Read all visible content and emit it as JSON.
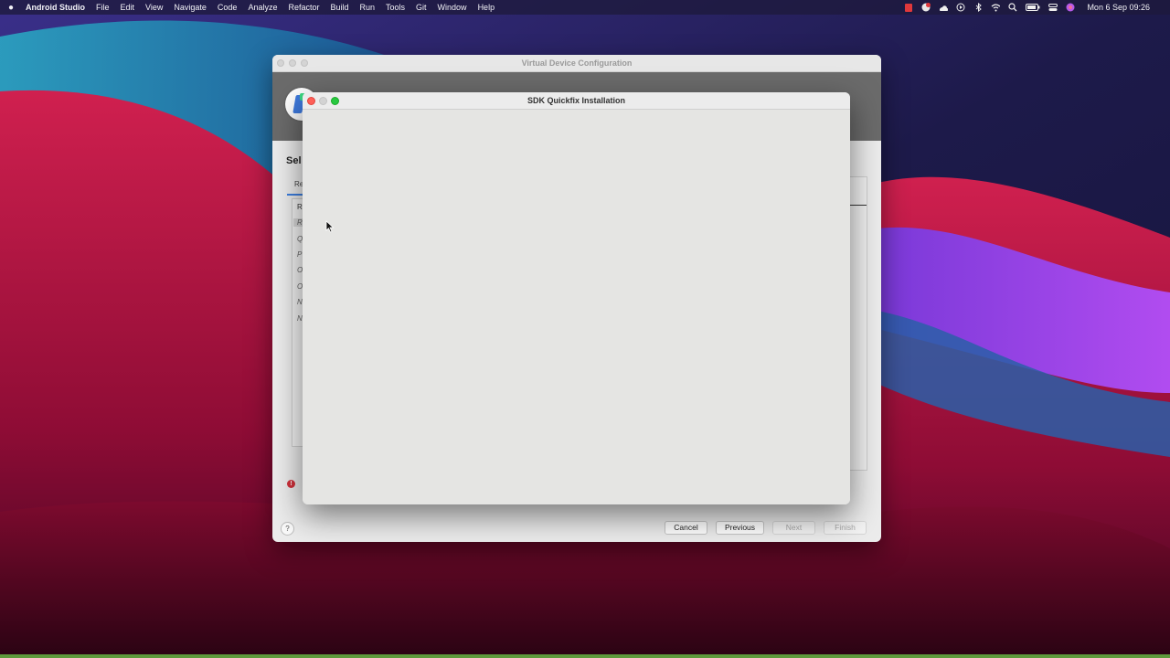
{
  "menubar": {
    "app_name": "Android Studio",
    "items": [
      "File",
      "Edit",
      "View",
      "Navigate",
      "Code",
      "Analyze",
      "Refactor",
      "Build",
      "Run",
      "Tools",
      "Git",
      "Window",
      "Help"
    ],
    "clock": "Mon 6 Sep  09:26",
    "status_icons": [
      "record-icon",
      "notification-icon",
      "cloud-icon",
      "play-circle-icon",
      "bluetooth-icon",
      "wifi-icon",
      "search-icon",
      "battery-icon",
      "control-center-icon",
      "siri-icon"
    ]
  },
  "vdc_window": {
    "title": "Virtual Device Configuration",
    "heading": "Sel",
    "tab_label": "Re",
    "table_header": "R",
    "rows": [
      "R",
      "Q",
      "P",
      "O",
      "O",
      "N",
      "N"
    ],
    "buttons": {
      "cancel": "Cancel",
      "previous": "Previous",
      "next": "Next",
      "finish": "Finish"
    },
    "help": "?",
    "error_glyph": "!"
  },
  "sdk_window": {
    "title": "SDK Quickfix Installation"
  },
  "colors": {
    "banner": "#6b6b6b",
    "close": "#fe5f57",
    "zoom": "#28c840",
    "error": "#d0323c",
    "tab_accent": "#3d7fe0"
  }
}
